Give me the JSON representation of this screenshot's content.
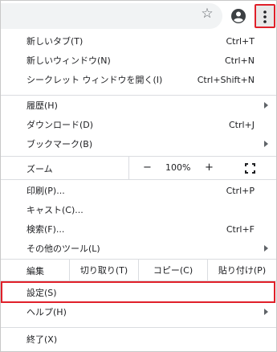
{
  "toolbar": {
    "star_icon": "bookmark-star-icon",
    "avatar_icon": "account-avatar-icon",
    "menu_icon": "three-dot-menu-icon",
    "highlight_color": "#e0202a"
  },
  "menu": {
    "new_tab": {
      "label": "新しいタブ(T)",
      "shortcut": "Ctrl+T"
    },
    "new_window": {
      "label": "新しいウィンドウ(N)",
      "shortcut": "Ctrl+N"
    },
    "incognito": {
      "label": "シークレット ウィンドウを開く(I)",
      "shortcut": "Ctrl+Shift+N"
    },
    "history": {
      "label": "履歴(H)"
    },
    "downloads": {
      "label": "ダウンロード(D)",
      "shortcut": "Ctrl+J"
    },
    "bookmarks": {
      "label": "ブックマーク(B)"
    },
    "zoom": {
      "label": "ズーム",
      "minus": "−",
      "level": "100%",
      "plus": "+"
    },
    "print": {
      "label": "印刷(P)...",
      "shortcut": "Ctrl+P"
    },
    "cast": {
      "label": "キャスト(C)..."
    },
    "find": {
      "label": "検索(F)...",
      "shortcut": "Ctrl+F"
    },
    "more_tools": {
      "label": "その他のツール(L)"
    },
    "edit": {
      "label": "編集",
      "cut": "切り取り(T)",
      "copy": "コピー(C)",
      "paste": "貼り付け(P)"
    },
    "settings": {
      "label": "設定(S)"
    },
    "help": {
      "label": "ヘルプ(H)"
    },
    "exit": {
      "label": "終了(X)"
    }
  }
}
